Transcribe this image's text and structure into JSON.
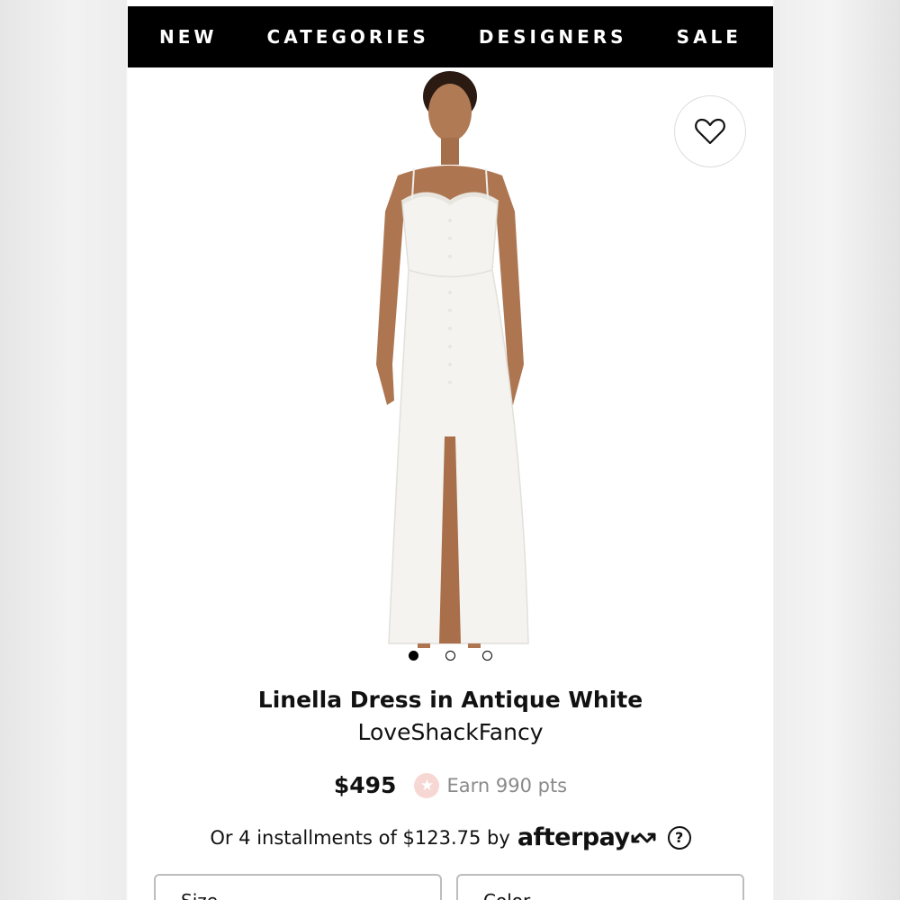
{
  "nav": {
    "items": [
      "NEW",
      "CATEGORIES",
      "DESIGNERS",
      "SALE"
    ]
  },
  "product": {
    "title": "Linella Dress in Antique White",
    "brand": "LoveShackFancy",
    "price": "$495",
    "points": "Earn 990 pts",
    "installments_text": "Or 4 installments of $123.75 by",
    "afterpay_logo": "afterpay",
    "help_glyph": "?",
    "image_count": 3,
    "active_image": 1
  },
  "selects": {
    "size_label": "Size",
    "color_label": "Color"
  },
  "icons": {
    "wishlist": "heart-outline-icon",
    "points": "star-icon",
    "afterpay": "afterpay-arrows-icon",
    "help": "question-circle-icon"
  },
  "colors": {
    "nav_bg": "#000000",
    "nav_text": "#ffffff",
    "points_badge": "#f6d7d3",
    "muted_text": "#8a8a8a"
  }
}
